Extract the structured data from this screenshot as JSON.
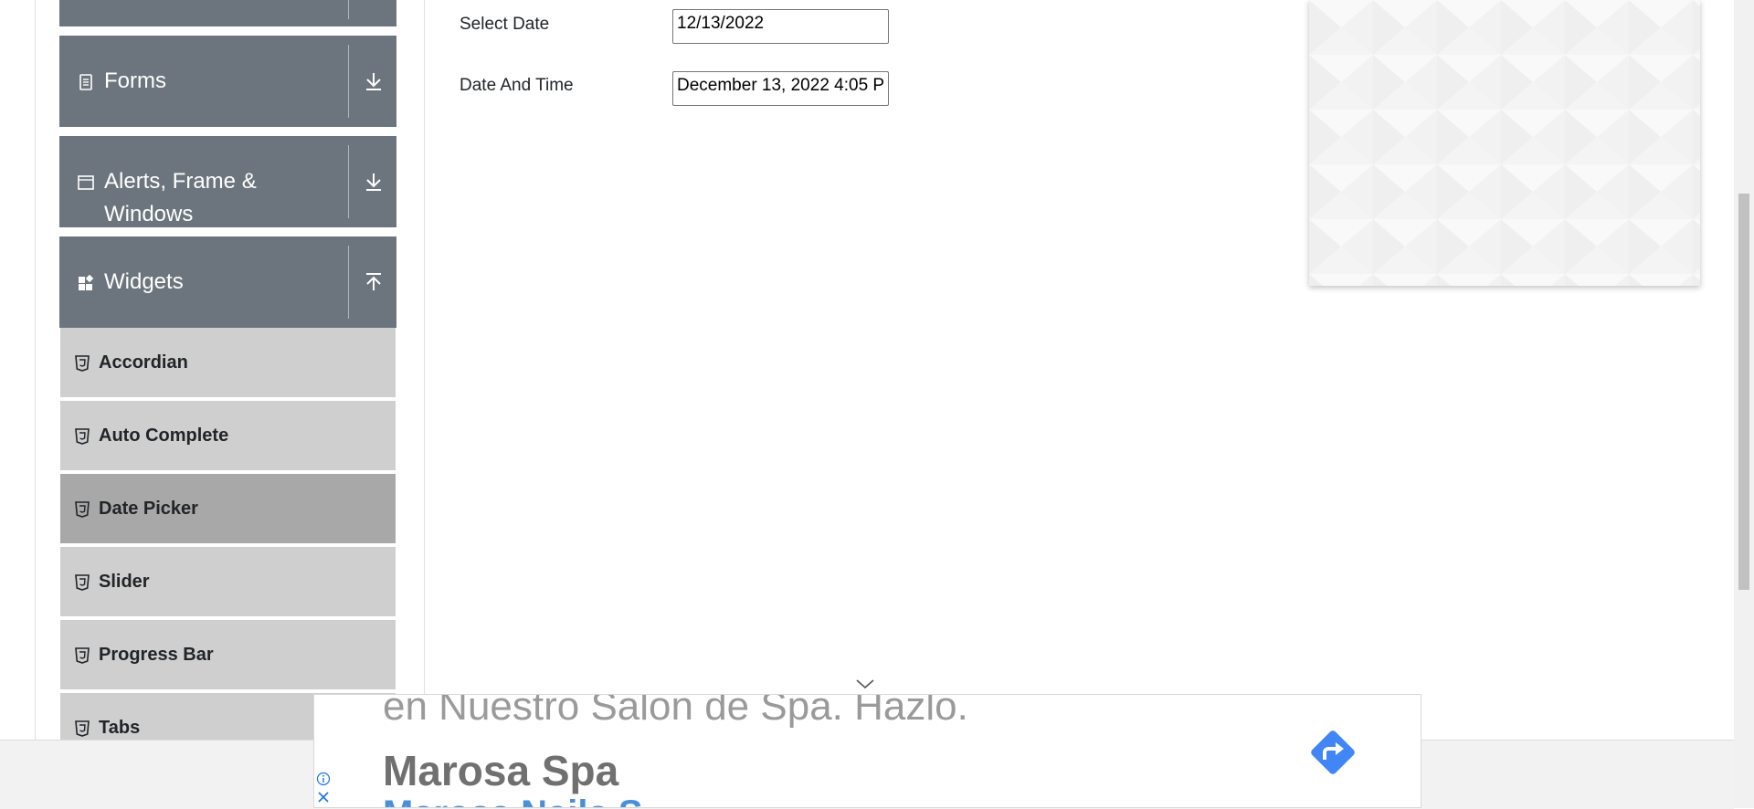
{
  "sidebar": {
    "groups": [
      {
        "label": "Forms",
        "icon": "document-icon",
        "toggle": "download-arrow-icon"
      },
      {
        "label": "Alerts, Frame &",
        "label_line2": "Windows",
        "icon": "window-icon",
        "toggle": "download-arrow-icon"
      },
      {
        "label": "Widgets",
        "icon": "widgets-icon",
        "toggle": "upload-arrow-icon"
      }
    ],
    "items": [
      {
        "label": "Accordian"
      },
      {
        "label": "Auto Complete"
      },
      {
        "label": "Date Picker",
        "active": true
      },
      {
        "label": "Slider"
      },
      {
        "label": "Progress Bar"
      },
      {
        "label": "Tabs"
      }
    ],
    "header_color": "#6c757d",
    "item_color": "#cfcfcf",
    "active_item_color": "#a8a8a8"
  },
  "form": {
    "select_date_label": "Select Date",
    "select_date_value": "12/13/2022",
    "date_time_label": "Date And Time",
    "date_time_value": "December 13, 2022 4:05 P"
  },
  "ad": {
    "tagline": "en Nuestro Salon de Spa. Hazlo.",
    "name": "Marosa Spa",
    "sub": "Marosa Nails S...",
    "arrow_color": "#4285f4"
  }
}
